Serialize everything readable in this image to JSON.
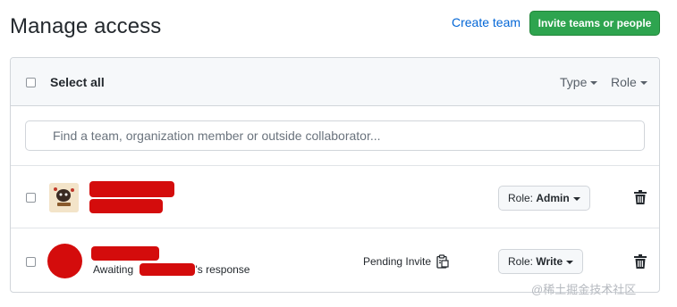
{
  "header": {
    "title": "Manage access",
    "create_team_label": "Create team",
    "invite_label": "Invite teams or people"
  },
  "panel": {
    "select_all_label": "Select all",
    "type_filter_label": "Type",
    "role_filter_label": "Role",
    "search_placeholder": "Find a team, organization member or outside collaborator..."
  },
  "members": [
    {
      "role_prefix": "Role: ",
      "role_value": "Admin"
    },
    {
      "awaiting_prefix": "Awaiting",
      "awaiting_suffix": "'s response",
      "pending_label": "Pending Invite",
      "role_prefix": "Role: ",
      "role_value": "Write"
    }
  ],
  "icons": {
    "search": "search-icon",
    "trash": "trash-icon",
    "clipboard": "clipboard-icon",
    "caret": "caret-down-icon"
  },
  "colors": {
    "primary_button": "#2ea44f",
    "link": "#0366d6",
    "redaction": "#d40c0c"
  },
  "watermark": "@稀土掘金技术社区"
}
